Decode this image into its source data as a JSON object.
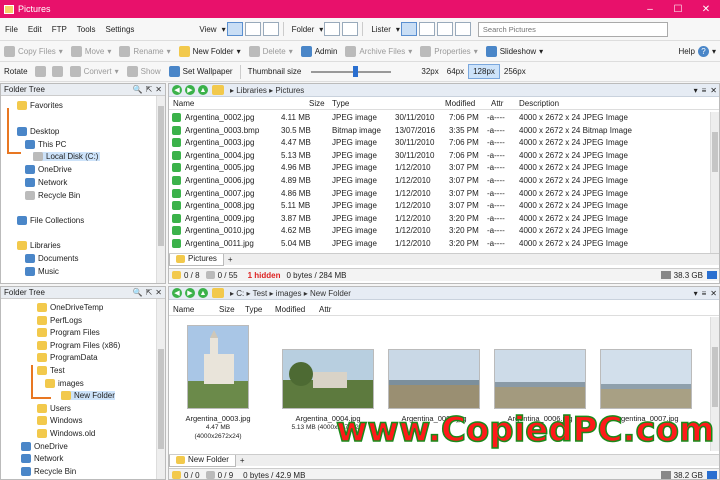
{
  "window": {
    "title": "Pictures",
    "controls": [
      "–",
      "☐",
      "✕"
    ]
  },
  "menu": {
    "items": [
      "File",
      "Edit",
      "FTP",
      "Tools",
      "Settings"
    ],
    "view_label": "View",
    "folder_label": "Folder",
    "lister_label": "Lister",
    "search_placeholder": "Search Pictures"
  },
  "toolbar1": {
    "copy": "Copy Files",
    "move": "Move",
    "rename": "Rename",
    "new_folder": "New Folder",
    "delete": "Delete",
    "admin": "Admin",
    "archive": "Archive Files",
    "properties": "Properties",
    "slideshow": "Slideshow",
    "help": "Help"
  },
  "toolbar2": {
    "rotate": "Rotate",
    "convert": "Convert",
    "show": "Show",
    "set_wallpaper": "Set Wallpaper",
    "thumb_size_label": "Thumbnail size",
    "sizes": [
      "32px",
      "64px",
      "128px",
      "256px"
    ],
    "selected_size": "128px"
  },
  "tree_top": {
    "header": "Folder Tree",
    "items": [
      "Favorites",
      "Desktop",
      "This PC",
      "Local Disk (C:)",
      "OneDrive",
      "Network",
      "Recycle Bin",
      "File Collections",
      "Libraries",
      "Documents",
      "Music"
    ]
  },
  "tree_bottom": {
    "header": "Folder Tree",
    "items": [
      "OneDriveTemp",
      "PerfLogs",
      "Program Files",
      "Program Files (x86)",
      "ProgramData",
      "Test",
      "images",
      "New Folder",
      "Users",
      "Windows",
      "Windows.old",
      "OneDrive",
      "Network",
      "Recycle Bin"
    ]
  },
  "pane_top": {
    "path": [
      "Libraries",
      "Pictures"
    ],
    "columns": [
      "Name",
      "Size",
      "Type",
      "Modified",
      "Attr",
      "Description"
    ],
    "rows": [
      {
        "name": "Argentina_0002.jpg",
        "size": "4.11 MB",
        "type": "JPEG image",
        "date": "30/11/2010",
        "time": "7:06 PM",
        "attr": "-a----",
        "desc": "4000 x 2672 x 24 JPEG Image"
      },
      {
        "name": "Argentina_0003.bmp",
        "size": "30.5 MB",
        "type": "Bitmap image",
        "date": "13/07/2016",
        "time": "3:35 PM",
        "attr": "-a----",
        "desc": "4000 x 2672 x 24 Bitmap Image"
      },
      {
        "name": "Argentina_0003.jpg",
        "size": "4.47 MB",
        "type": "JPEG image",
        "date": "30/11/2010",
        "time": "7:06 PM",
        "attr": "-a----",
        "desc": "4000 x 2672 x 24 JPEG Image"
      },
      {
        "name": "Argentina_0004.jpg",
        "size": "5.13 MB",
        "type": "JPEG image",
        "date": "30/11/2010",
        "time": "7:06 PM",
        "attr": "-a----",
        "desc": "4000 x 2672 x 24 JPEG Image"
      },
      {
        "name": "Argentina_0005.jpg",
        "size": "4.96 MB",
        "type": "JPEG image",
        "date": "1/12/2010",
        "time": "3:07 PM",
        "attr": "-a----",
        "desc": "4000 x 2672 x 24 JPEG Image"
      },
      {
        "name": "Argentina_0006.jpg",
        "size": "4.89 MB",
        "type": "JPEG image",
        "date": "1/12/2010",
        "time": "3:07 PM",
        "attr": "-a----",
        "desc": "4000 x 2672 x 24 JPEG Image"
      },
      {
        "name": "Argentina_0007.jpg",
        "size": "4.86 MB",
        "type": "JPEG image",
        "date": "1/12/2010",
        "time": "3:07 PM",
        "attr": "-a----",
        "desc": "4000 x 2672 x 24 JPEG Image"
      },
      {
        "name": "Argentina_0008.jpg",
        "size": "5.11 MB",
        "type": "JPEG image",
        "date": "1/12/2010",
        "time": "3:07 PM",
        "attr": "-a----",
        "desc": "4000 x 2672 x 24 JPEG Image"
      },
      {
        "name": "Argentina_0009.jpg",
        "size": "3.87 MB",
        "type": "JPEG image",
        "date": "1/12/2010",
        "time": "3:20 PM",
        "attr": "-a----",
        "desc": "4000 x 2672 x 24 JPEG Image"
      },
      {
        "name": "Argentina_0010.jpg",
        "size": "4.62 MB",
        "type": "JPEG image",
        "date": "1/12/2010",
        "time": "3:20 PM",
        "attr": "-a----",
        "desc": "4000 x 2672 x 24 JPEG Image"
      },
      {
        "name": "Argentina_0011.jpg",
        "size": "5.04 MB",
        "type": "JPEG image",
        "date": "1/12/2010",
        "time": "3:20 PM",
        "attr": "-a----",
        "desc": "4000 x 2672 x 24 JPEG Image"
      }
    ],
    "tab": "Pictures",
    "status": {
      "sel": "0 / 8",
      "files": "0 / 55",
      "hidden": "1 hidden",
      "bytes": "0 bytes / 284 MB",
      "free": "38.3 GB"
    }
  },
  "pane_bottom": {
    "path": [
      "C:",
      "Test",
      "images",
      "New Folder"
    ],
    "columns": [
      "Name",
      "Size",
      "Type",
      "Modified",
      "Attr"
    ],
    "thumbs": [
      {
        "name": "Argentina_0003.jpg",
        "info": "4.47 MB (4000x2672x24)"
      },
      {
        "name": "Argentina_0004.jpg",
        "info": "5.13 MB (4000x2672x24)"
      },
      {
        "name": "Argentina_0005.jpg",
        "info": ""
      },
      {
        "name": "Argentina_0006.jpg",
        "info": ""
      },
      {
        "name": "Argentina_0007.jpg",
        "info": ""
      }
    ],
    "tab": "New Folder",
    "status": {
      "sel": "0 / 0",
      "files": "0 / 9",
      "bytes": "0 bytes / 42.9 MB",
      "free": "38.2 GB"
    }
  },
  "watermark": "www.CopiedPC.com",
  "colors": {
    "titlebar": "#e8116b",
    "watermark_fill": "#ff1a1a",
    "watermark_stroke": "#1a8a1a",
    "selection": "#cde3fa"
  }
}
